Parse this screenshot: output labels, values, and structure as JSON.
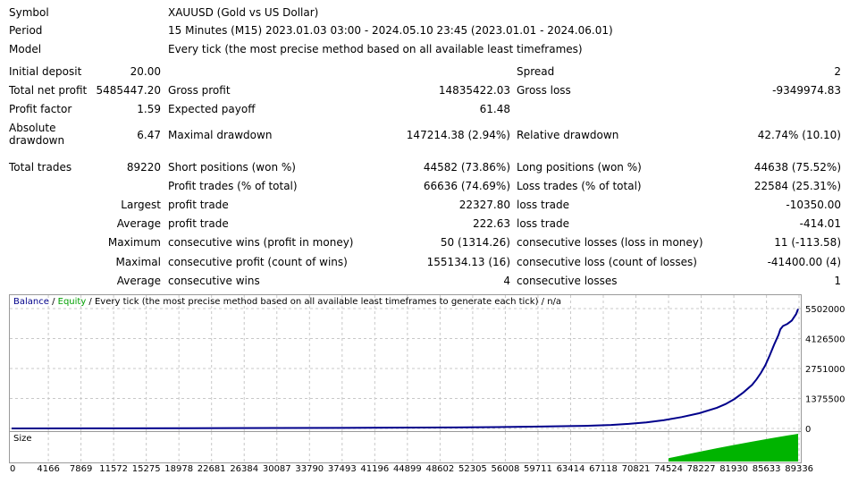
{
  "header": {
    "symbol_label": "Symbol",
    "symbol_value": "XAUUSD (Gold vs US Dollar)",
    "period_label": "Period",
    "period_value": "15 Minutes (M15) 2023.01.03 03:00 - 2024.05.10 23:45 (2023.01.01 - 2024.06.01)",
    "model_label": "Model",
    "model_value": "Every tick (the most precise method based on all available least timeframes)"
  },
  "stats": {
    "initial_deposit_label": "Initial deposit",
    "initial_deposit_value": "20.00",
    "spread_label": "Spread",
    "spread_value": "2",
    "total_net_profit_label": "Total net profit",
    "total_net_profit_value": "5485447.20",
    "gross_profit_label": "Gross profit",
    "gross_profit_value": "14835422.03",
    "gross_loss_label": "Gross loss",
    "gross_loss_value": "-9349974.83",
    "profit_factor_label": "Profit factor",
    "profit_factor_value": "1.59",
    "expected_payoff_label": "Expected payoff",
    "expected_payoff_value": "61.48",
    "absolute_drawdown_label_1": "Absolute",
    "absolute_drawdown_label_2": "drawdown",
    "absolute_drawdown_value": "6.47",
    "maximal_drawdown_label": "Maximal drawdown",
    "maximal_drawdown_value": "147214.38 (2.94%)",
    "relative_drawdown_label": "Relative drawdown",
    "relative_drawdown_value": "42.74% (10.10)",
    "total_trades_label": "Total trades",
    "total_trades_value": "89220",
    "short_positions_label": "Short positions (won %)",
    "short_positions_value": "44582 (73.86%)",
    "long_positions_label": "Long positions (won %)",
    "long_positions_value": "44638 (75.52%)",
    "profit_trades_label": "Profit trades (% of total)",
    "profit_trades_value": "66636 (74.69%)",
    "loss_trades_label": "Loss trades (% of total)",
    "loss_trades_value": "22584 (25.31%)",
    "largest_label": "Largest",
    "largest_profit_trade_label": "profit trade",
    "largest_profit_trade_value": "22327.80",
    "largest_loss_trade_label": "loss trade",
    "largest_loss_trade_value": "-10350.00",
    "average_label": "Average",
    "average_profit_trade_label": "profit trade",
    "average_profit_trade_value": "222.63",
    "average_loss_trade_label": "loss trade",
    "average_loss_trade_value": "-414.01",
    "maximum_label": "Maximum",
    "max_consec_wins_label": "consecutive wins (profit in money)",
    "max_consec_wins_value": "50 (1314.26)",
    "max_consec_losses_label": "consecutive losses (loss in money)",
    "max_consec_losses_value": "11 (-113.58)",
    "maximal_label": "Maximal",
    "maximal_consec_profit_label": "consecutive profit (count of wins)",
    "maximal_consec_profit_value": "155134.13 (16)",
    "maximal_consec_loss_label": "consecutive loss (count of losses)",
    "maximal_consec_loss_value": "-41400.00 (4)",
    "average2_label": "Average",
    "avg_consec_wins_label": "consecutive wins",
    "avg_consec_wins_value": "4",
    "avg_consec_losses_label": "consecutive losses",
    "avg_consec_losses_value": "1"
  },
  "chart_data": {
    "type": "line",
    "legend": {
      "balance": "Balance",
      "sep1": " / ",
      "equity": "Equity",
      "sep2": " / ",
      "note": "Every tick (the most precise method based on all available least timeframes to generate each tick)",
      "sep3": " / ",
      "na": "n/a"
    },
    "colors": {
      "balance": "#00008b",
      "equity": "#00a000",
      "grid": "#c8c8c8",
      "size": "#00b400"
    },
    "y_ticks": [
      "5502000",
      "4126500",
      "2751000",
      "1375500",
      "0"
    ],
    "y_tick_values": [
      5502000,
      4126500,
      2751000,
      1375500,
      0
    ],
    "ylim": [
      0,
      5502000
    ],
    "xlim": [
      0,
      89220
    ],
    "x_ticks": [
      "0",
      "4166",
      "7869",
      "11572",
      "15275",
      "18978",
      "22681",
      "26384",
      "30087",
      "33790",
      "37493",
      "41196",
      "44899",
      "48602",
      "52305",
      "56008",
      "59711",
      "63414",
      "67118",
      "70821",
      "74524",
      "78227",
      "81930",
      "85633",
      "89336"
    ],
    "x_tick_values": [
      0,
      4166,
      7869,
      11572,
      15275,
      18978,
      22681,
      26384,
      30087,
      33790,
      37493,
      41196,
      44899,
      48602,
      52305,
      56008,
      59711,
      63414,
      67118,
      70821,
      74524,
      78227,
      81930,
      85633,
      89336
    ],
    "series": [
      {
        "name": "Balance",
        "x": [
          0,
          10000,
          20000,
          30000,
          40000,
          50000,
          55000,
          60000,
          65000,
          68000,
          70000,
          72000,
          74000,
          76000,
          78000,
          80000,
          81000,
          82000,
          83000,
          84000,
          84500,
          85000,
          85500,
          86000,
          86500,
          87000,
          87200,
          87500,
          88000,
          88500,
          89000,
          89220
        ],
        "y": [
          20,
          5000,
          12000,
          20000,
          30000,
          45000,
          60000,
          85000,
          120000,
          160000,
          210000,
          280000,
          380000,
          520000,
          700000,
          950000,
          1120000,
          1350000,
          1650000,
          2000000,
          2250000,
          2550000,
          2900000,
          3350000,
          3850000,
          4300000,
          4550000,
          4700000,
          4800000,
          4950000,
          5250000,
          5485447
        ]
      }
    ],
    "size_panel": {
      "label": "Size",
      "x": [
        74524,
        76000,
        78000,
        80000,
        82000,
        84000,
        86000,
        88000,
        89220
      ],
      "y": [
        0.12,
        0.22,
        0.35,
        0.48,
        0.6,
        0.72,
        0.83,
        0.94,
        1.0
      ]
    }
  }
}
